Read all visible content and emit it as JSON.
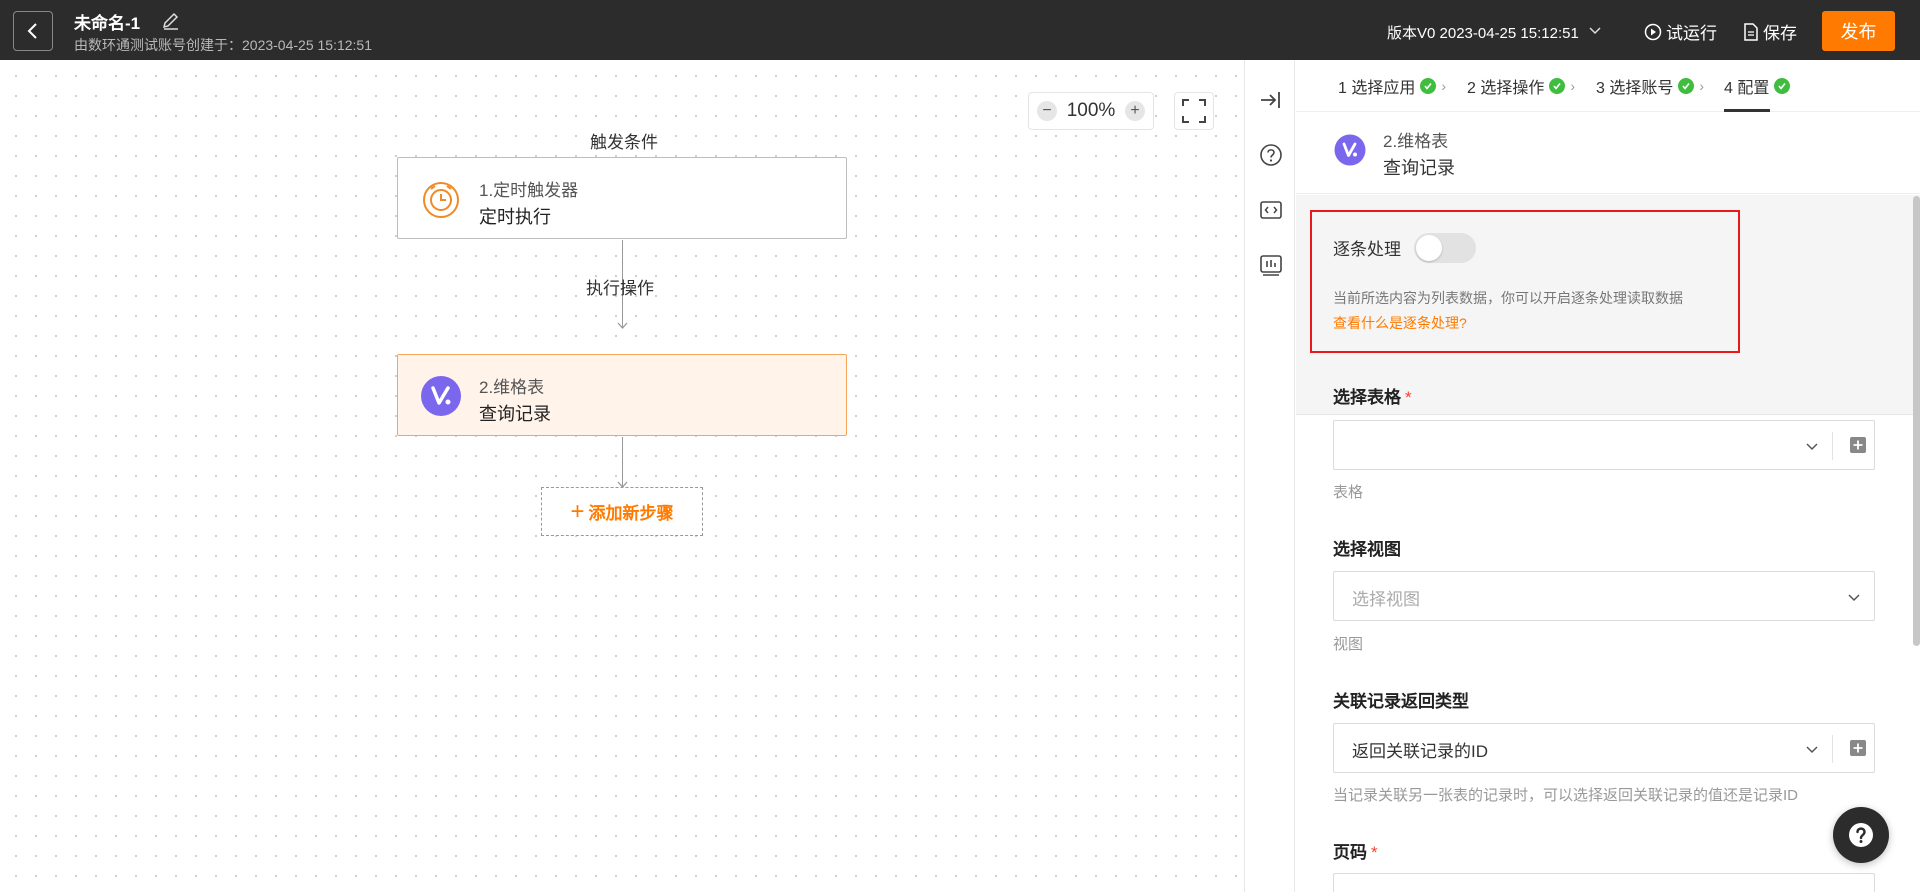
{
  "header": {
    "title": "未命名-1",
    "subtitle": "由数环通测试账号创建于：2023-04-25 15:12:51",
    "version": "版本V0 2023-04-25 15:12:51",
    "test_run_label": "试运行",
    "save_label": "保存",
    "publish_label": "发布"
  },
  "canvas": {
    "zoom": "100%",
    "zoom_out": "−",
    "zoom_in": "+",
    "trigger_label": "触发条件",
    "exec_label": "执行操作",
    "nodes": [
      {
        "line1": "1.定时触发器",
        "line2": "定时执行"
      },
      {
        "line1": "2.维格表",
        "line2": "查询记录"
      }
    ],
    "add_step_label": "添加新步骤",
    "add_step_plus": "+"
  },
  "panel": {
    "steps": [
      {
        "label": "1 选择应用"
      },
      {
        "label": "2 选择操作"
      },
      {
        "label": "3 选择账号"
      },
      {
        "label": "4 配置"
      }
    ],
    "app": {
      "line1": "2.维格表",
      "line2": "查询记录"
    },
    "item_processing": {
      "label": "逐条处理",
      "enabled": false,
      "description": "当前所选内容为列表数据，你可以开启逐条处理读取数据",
      "link": "查看什么是逐条处理?"
    },
    "fields": {
      "table": {
        "label": "选择表格",
        "required": "*",
        "value": "",
        "hint": "表格"
      },
      "view": {
        "label": "选择视图",
        "placeholder": "选择视图",
        "hint": "视图"
      },
      "return_type": {
        "label": "关联记录返回类型",
        "value": "返回关联记录的ID",
        "hint": "当记录关联另一张表的记录时，可以选择返回关联记录的值还是记录ID"
      },
      "page": {
        "label": "页码",
        "required": "*"
      }
    }
  },
  "colors": {
    "accent": "#ff7a00",
    "header_bg": "#2c2c2c",
    "success": "#3ebd3e",
    "highlight_border": "#e8181d"
  }
}
